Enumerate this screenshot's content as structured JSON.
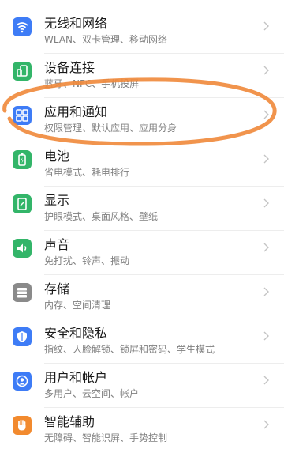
{
  "settings": {
    "items": [
      {
        "title": "无线和网络",
        "subtitle": "WLAN、双卡管理、移动网络",
        "icon": "wifi-icon",
        "color": "#3e7cf6"
      },
      {
        "title": "设备连接",
        "subtitle": "蓝牙、NFC、手机投屏",
        "icon": "device-connect-icon",
        "color": "#33b569"
      },
      {
        "title": "应用和通知",
        "subtitle": "权限管理、默认应用、应用分身",
        "icon": "apps-icon",
        "color": "#3e7cf6"
      },
      {
        "title": "电池",
        "subtitle": "省电模式、耗电排行",
        "icon": "battery-icon",
        "color": "#33b569"
      },
      {
        "title": "显示",
        "subtitle": "护眼模式、桌面风格、壁纸",
        "icon": "display-icon",
        "color": "#33b569"
      },
      {
        "title": "声音",
        "subtitle": "免打扰、铃声、振动",
        "icon": "sound-icon",
        "color": "#33b569"
      },
      {
        "title": "存储",
        "subtitle": "内存、空间清理",
        "icon": "storage-icon",
        "color": "#8a8a8a"
      },
      {
        "title": "安全和隐私",
        "subtitle": "指纹、人脸解锁、锁屏和密码、学生模式",
        "icon": "shield-icon",
        "color": "#3e7cf6"
      },
      {
        "title": "用户和帐户",
        "subtitle": "多用户、云空间、帐户",
        "icon": "user-icon",
        "color": "#3e7cf6"
      },
      {
        "title": "智能辅助",
        "subtitle": "无障碍、智能识屏、手势控制",
        "icon": "hand-icon",
        "color": "#f28a2e"
      }
    ]
  },
  "annotation": {
    "color": "#f0883a"
  }
}
